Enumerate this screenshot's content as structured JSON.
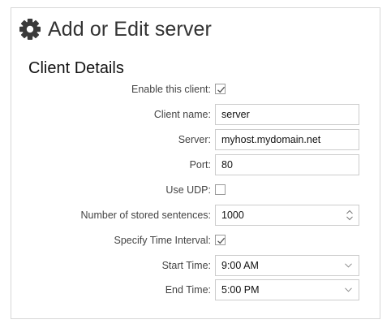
{
  "dialog": {
    "title": "Add or Edit server",
    "section_title": "Client Details"
  },
  "form": {
    "enable_client": {
      "label": "Enable this client:",
      "checked": true
    },
    "client_name": {
      "label": "Client name:",
      "value": "server"
    },
    "server": {
      "label": "Server:",
      "value": "myhost.mydomain.net"
    },
    "port": {
      "label": "Port:",
      "value": "80"
    },
    "use_udp": {
      "label": "Use UDP:",
      "checked": false
    },
    "stored_sentences": {
      "label": "Number of stored sentences:",
      "value": "1000"
    },
    "specify_time_interval": {
      "label": "Specify Time Interval:",
      "checked": true
    },
    "start_time": {
      "label": "Start Time:",
      "value": "9:00 AM"
    },
    "end_time": {
      "label": "End Time:",
      "value": "5:00 PM"
    }
  },
  "icons": {
    "header": "gear-icon",
    "checkbox": "checkmark-icon",
    "spinner": "spinner-arrows-icon",
    "dropdown": "chevron-down-icon"
  }
}
